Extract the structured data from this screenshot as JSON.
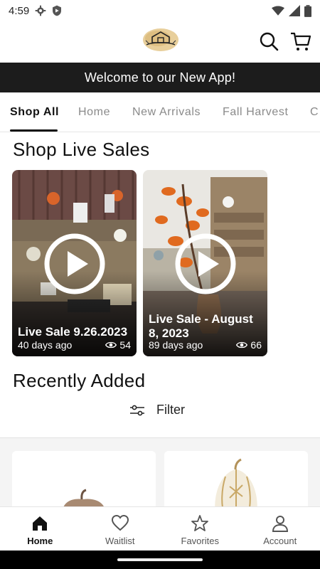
{
  "status_bar": {
    "time": "4:59",
    "icons": [
      "settings-icon",
      "shield-icon",
      "wifi-icon",
      "signal-icon",
      "battery-icon"
    ]
  },
  "header": {
    "logo": "store-logo",
    "icons": [
      "search-icon",
      "cart-icon"
    ]
  },
  "banner": {
    "text": "Welcome to our New App!"
  },
  "tabs": [
    {
      "label": "Shop All",
      "active": true
    },
    {
      "label": "Home",
      "active": false
    },
    {
      "label": "New Arrivals",
      "active": false
    },
    {
      "label": "Fall Harvest",
      "active": false
    },
    {
      "label": "C",
      "active": false
    }
  ],
  "live_sales": {
    "title": "Shop Live Sales",
    "items": [
      {
        "title": "Live Sale 9.26.2023",
        "age": "40 days ago",
        "views": "54"
      },
      {
        "title": "Live Sale - August 8, 2023",
        "age": "89 days ago",
        "views": "66"
      }
    ]
  },
  "recent": {
    "title": "Recently Added",
    "filter_label": "Filter"
  },
  "nav": [
    {
      "label": "Home",
      "icon": "home-icon",
      "active": true
    },
    {
      "label": "Waitlist",
      "icon": "heart-icon",
      "active": false
    },
    {
      "label": "Favorites",
      "icon": "star-icon",
      "active": false
    },
    {
      "label": "Account",
      "icon": "account-icon",
      "active": false
    }
  ],
  "colors": {
    "banner_bg": "#1c1c1c",
    "accent": "#111111",
    "tab_inactive": "#8a8a8a"
  }
}
